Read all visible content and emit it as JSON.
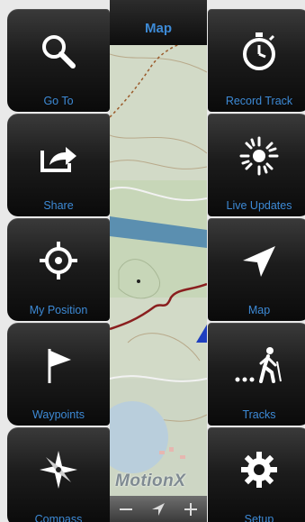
{
  "map_header": {
    "title": "Map"
  },
  "brand": {
    "name": "MotionX"
  },
  "left_buttons": [
    {
      "label": "Go To",
      "icon": "magnifier-icon"
    },
    {
      "label": "Share",
      "icon": "share-icon"
    },
    {
      "label": "My Position",
      "icon": "crosshair-icon"
    },
    {
      "label": "Waypoints",
      "icon": "flag-icon"
    },
    {
      "label": "Compass",
      "icon": "compass-rose-icon"
    }
  ],
  "right_buttons": [
    {
      "label": "Record Track",
      "icon": "stopwatch-icon"
    },
    {
      "label": "Live Updates",
      "icon": "sunburst-icon"
    },
    {
      "label": "Map",
      "icon": "arrow-pointer-icon"
    },
    {
      "label": "Tracks",
      "icon": "hiker-icon"
    },
    {
      "label": "Setup",
      "icon": "gear-icon"
    }
  ],
  "colors": {
    "label": "#3d8ad6",
    "tile": "#1c1c1c",
    "track": "#8a1f1f",
    "water": "#5b8fb0"
  }
}
